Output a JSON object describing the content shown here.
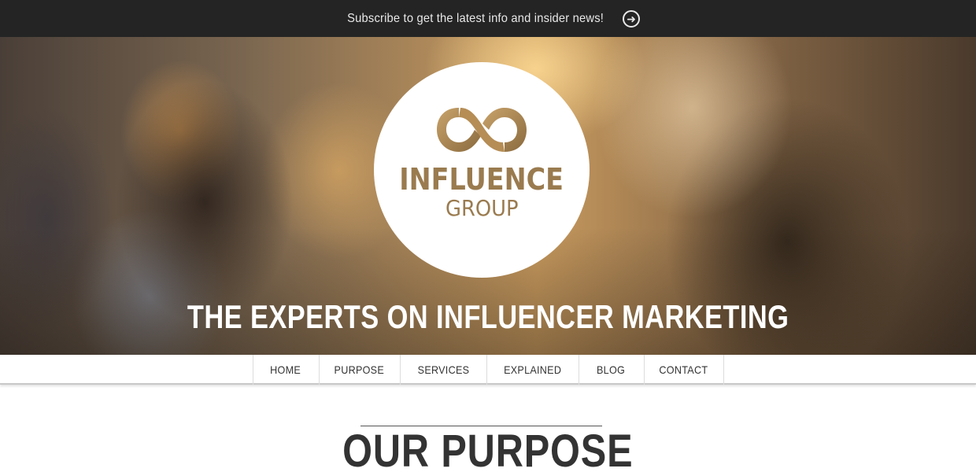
{
  "topbar": {
    "subscribe_text": "Subscribe to get the latest info and insider news!",
    "arrow_glyph": "➜",
    "background": "#242424"
  },
  "hero": {
    "logo": {
      "line1": "INFLUENCE",
      "line2": "GROUP",
      "color": "#9a7b4f"
    },
    "headline": "THE EXPERTS ON INFLUENCER MARKETING"
  },
  "nav": {
    "items": [
      {
        "label": "HOME"
      },
      {
        "label": "PURPOSE"
      },
      {
        "label": "SERVICES"
      },
      {
        "label": "EXPLAINED"
      },
      {
        "label": "BLOG"
      },
      {
        "label": "CONTACT"
      }
    ]
  },
  "main": {
    "section_title": "OUR PURPOSE"
  }
}
